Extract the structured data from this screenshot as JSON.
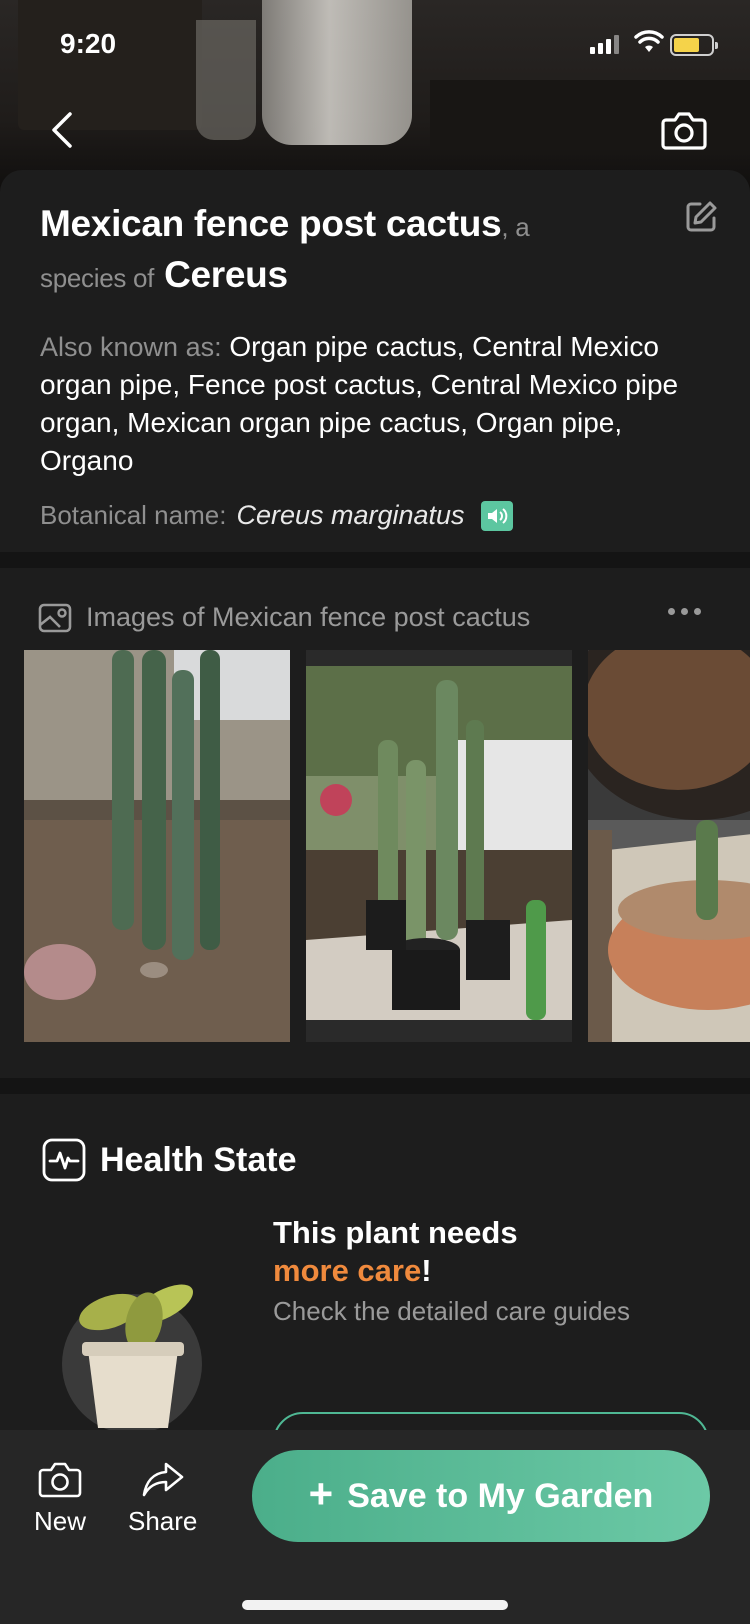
{
  "status_bar": {
    "time": "9:20"
  },
  "header": {
    "back_icon": "chevron-left-icon",
    "camera_icon": "camera-icon"
  },
  "plant": {
    "common_name": "Mexican fence post cactus",
    "species_connector_a": ", a",
    "species_connector_b": "species of",
    "genus": "Cereus",
    "aka_label": "Also known as:",
    "aka_values": "Organ pipe cactus, Central Mexico organ pipe, Fence post cactus, Central Mexico pipe organ, Mexican organ pipe cactus, Organ pipe, Organo",
    "botanical_label": "Botanical name:",
    "botanical_name": "Cereus marginatus",
    "edit_icon": "edit-icon",
    "sound_icon": "speaker-icon"
  },
  "images": {
    "heading": "Images of Mexican fence post cactus",
    "heading_icon": "image-icon",
    "more_icon": "more-horizontal-icon"
  },
  "health": {
    "title": "Health State",
    "title_icon": "pulse-icon",
    "needs_line": "This plant needs",
    "care_highlight": "more care",
    "care_suffix": "!",
    "guides_text": "Check the detailed care guides"
  },
  "bottom_bar": {
    "new_label": "New",
    "share_label": "Share",
    "save_plus": "+",
    "save_label": "Save to My Garden"
  },
  "colors": {
    "accent_green": "#5cc6a0",
    "care_orange": "#f08a3d"
  }
}
